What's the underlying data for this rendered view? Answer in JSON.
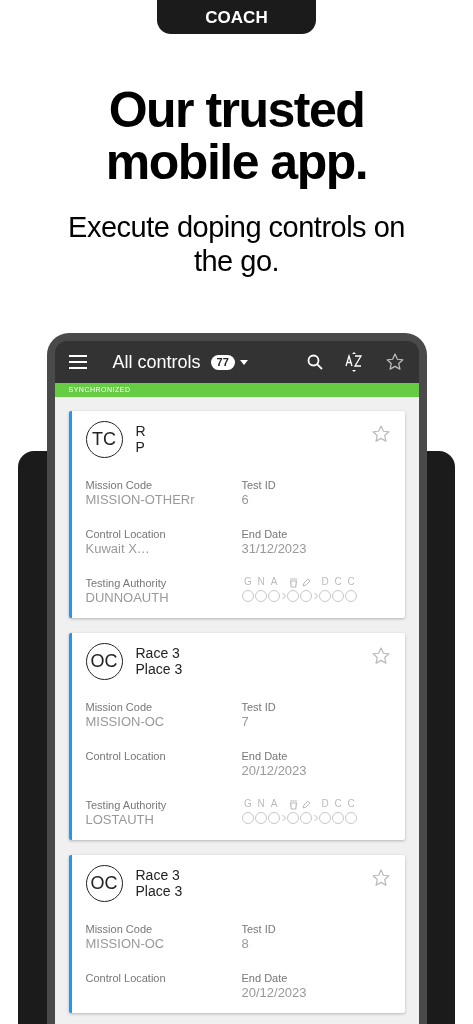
{
  "tag": "COACH",
  "headline": "Our trusted mobile app.",
  "subtitle": "Execute doping controls on the go.",
  "app_bar": {
    "title": "All controls",
    "count": "77"
  },
  "sync_status": "SYNCHRONIZED",
  "cards": [
    {
      "initials": "TC",
      "line_1": "R",
      "line_2": "P",
      "starred": false,
      "fields": [
        {
          "label": "Mission Code",
          "value": "MISSION-OTHERr"
        },
        {
          "label": "Test ID",
          "value": "6"
        },
        {
          "label": "Control Location",
          "value": "Kuwait X…"
        },
        {
          "label": "End Date",
          "value": "31/12/2023"
        },
        {
          "label": "Testing Authority",
          "value": "DUNNOAUTH"
        }
      ],
      "steps": [
        [
          {
            "kind": "letter",
            "label": "G"
          },
          {
            "kind": "letter",
            "label": "N"
          },
          {
            "kind": "letter",
            "label": "A"
          }
        ],
        [
          {
            "kind": "cup"
          },
          {
            "kind": "pen"
          }
        ],
        [
          {
            "kind": "letter",
            "label": "D"
          },
          {
            "kind": "letter",
            "label": "C"
          },
          {
            "kind": "letter",
            "label": "C"
          }
        ]
      ]
    },
    {
      "initials": "OC",
      "line_1": "Race 3",
      "line_2": "Place 3",
      "starred": false,
      "fields": [
        {
          "label": "Mission Code",
          "value": "MISSION-OC"
        },
        {
          "label": "Test ID",
          "value": "7"
        },
        {
          "label": "Control Location"
        },
        {
          "label": "End Date",
          "value": "20/12/2023"
        },
        {
          "label": "Testing Authority",
          "value": "LOSTAUTH"
        }
      ],
      "steps": [
        [
          {
            "kind": "letter",
            "label": "G"
          },
          {
            "kind": "letter",
            "label": "N"
          },
          {
            "kind": "letter",
            "label": "A"
          }
        ],
        [
          {
            "kind": "cup"
          },
          {
            "kind": "pen"
          }
        ],
        [
          {
            "kind": "letter",
            "label": "D"
          },
          {
            "kind": "letter",
            "label": "C"
          },
          {
            "kind": "letter",
            "label": "C"
          }
        ]
      ]
    },
    {
      "initials": "OC",
      "line_1": "Race 3",
      "line_2": "Place 3",
      "starred": false,
      "fields": [
        {
          "label": "Mission Code",
          "value": "MISSION-OC"
        },
        {
          "label": "Test ID",
          "value": "8"
        },
        {
          "label": "Control Location"
        },
        {
          "label": "End Date",
          "value": "20/12/2023"
        }
      ]
    }
  ]
}
